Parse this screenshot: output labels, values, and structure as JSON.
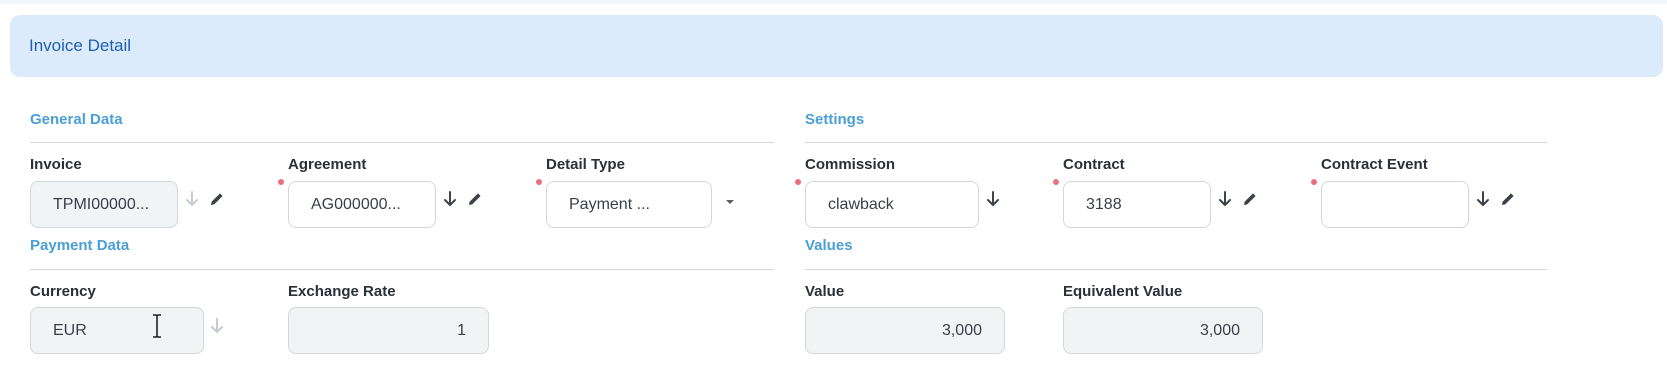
{
  "header": {
    "title": "Invoice Detail"
  },
  "sections": {
    "general": "General Data",
    "settings": "Settings",
    "payment": "Payment Data",
    "values": "Values"
  },
  "fields": {
    "invoice": {
      "label": "Invoice",
      "value": "TPMI00000..."
    },
    "agreement": {
      "label": "Agreement",
      "value": "AG000000..."
    },
    "detail_type": {
      "label": "Detail Type",
      "value": "Payment ..."
    },
    "commission": {
      "label": "Commission",
      "value": "clawback"
    },
    "contract": {
      "label": "Contract",
      "value": "3188"
    },
    "contract_event": {
      "label": "Contract Event",
      "value": ""
    },
    "currency": {
      "label": "Currency",
      "value": "EUR"
    },
    "exchange_rate": {
      "label": "Exchange Rate",
      "value": "1"
    },
    "value": {
      "label": "Value",
      "value": "3,000"
    },
    "equivalent_value": {
      "label": "Equivalent Value",
      "value": "3,000"
    }
  },
  "colors": {
    "header_bg": "#dcebfc",
    "header_text": "#1d5fb4",
    "section_title": "#4a9fd6",
    "required_dot": "#ec6f7b"
  },
  "icons": {
    "arrow": "arrow-down-icon",
    "edit": "pencil-icon",
    "dropdown": "caret-down-icon",
    "cursor": "text-cursor-icon"
  }
}
